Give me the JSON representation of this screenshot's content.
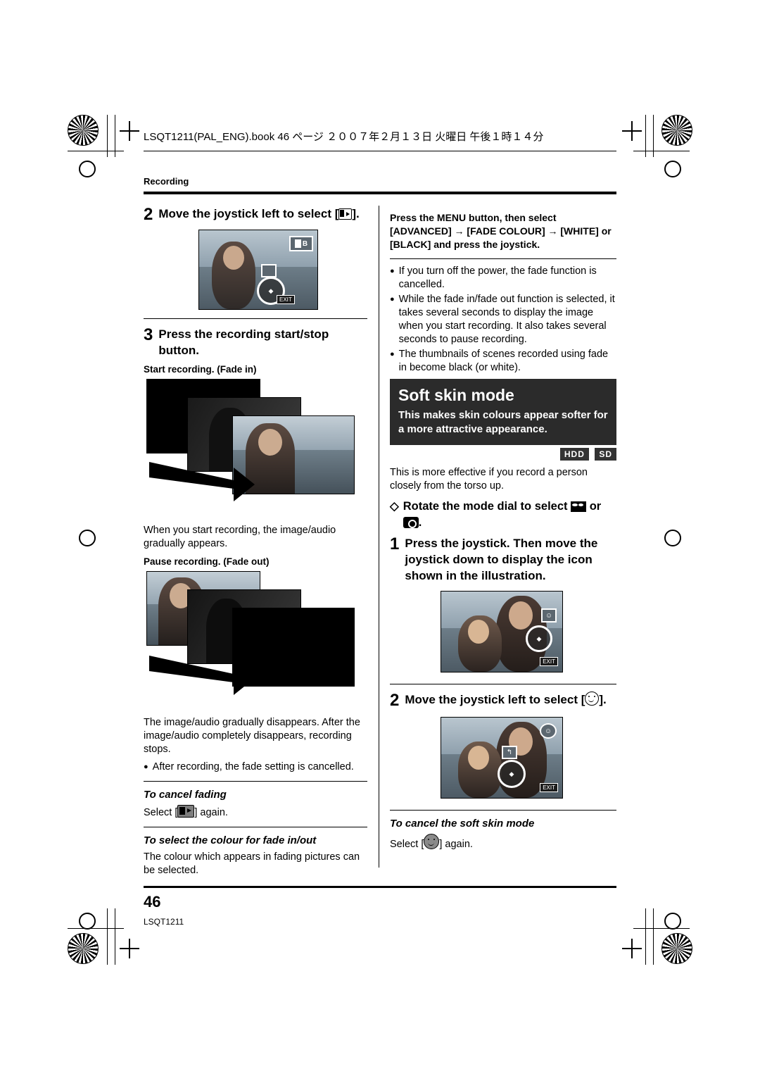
{
  "document": {
    "slug": "LSQT1211(PAL_ENG).book   46 ページ   ２００７年２月１３日   火曜日   午後１時１４分",
    "section": "Recording",
    "page_number": "46",
    "page_code": "LSQT1211"
  },
  "left_column": {
    "step2": {
      "num": "2",
      "text": "Move the joystick left to select [ ]."
    },
    "step3": {
      "num": "3",
      "text": "Press the recording start/stop button."
    },
    "fade_in_caption": "Start recording. (Fade in)",
    "fade_in_text": "When you start recording, the image/audio gradually appears.",
    "fade_out_caption": "Pause recording. (Fade out)",
    "fade_out_text": "The image/audio gradually disappears. After the image/audio completely disappears, recording stops.",
    "fade_out_bullet": "After recording, the fade setting is cancelled.",
    "cancel_heading": "To cancel fading",
    "cancel_text_pre": "Select [",
    "cancel_text_post": "] again.",
    "colour_heading": "To select the colour for fade in/out",
    "colour_text": "The colour which appears in fading pictures can be selected."
  },
  "right_column": {
    "menu_instruction": "Press the MENU button, then select [ADVANCED] → [FADE COLOUR] → [WHITE] or [BLACK] and press the joystick.",
    "bullets": [
      "If you turn off the power, the fade function is cancelled.",
      "While the fade in/fade out function is selected, it takes several seconds to display the image when you start recording. It also takes several seconds to pause recording.",
      "The thumbnails of scenes recorded using fade in become black (or white)."
    ],
    "band": {
      "title": "Soft skin mode",
      "subtitle": "This makes skin colours appear softer for a more attractive appearance."
    },
    "badges": [
      "HDD",
      "SD"
    ],
    "intro": "This is more effective if you record a person closely from the torso up.",
    "dial_instruction_pre": "Rotate the mode dial to select",
    "dial_instruction_mid": "or",
    "dial_instruction_post": ".",
    "step1": {
      "num": "1",
      "text": "Press the joystick. Then move the joystick down to display the icon shown in the illustration."
    },
    "step2": {
      "num": "2",
      "text": "Move the joystick left to select [ ]."
    },
    "cancel_heading": "To cancel the soft skin mode",
    "cancel_text_pre": "Select [",
    "cancel_text_post": "] again."
  },
  "icons": {
    "fade": "fade-icon",
    "soft_skin": "soft-skin-icon",
    "movie_mode": "movie-mode-icon",
    "photo_mode": "photo-mode-icon",
    "exit_tab": "EXIT"
  }
}
